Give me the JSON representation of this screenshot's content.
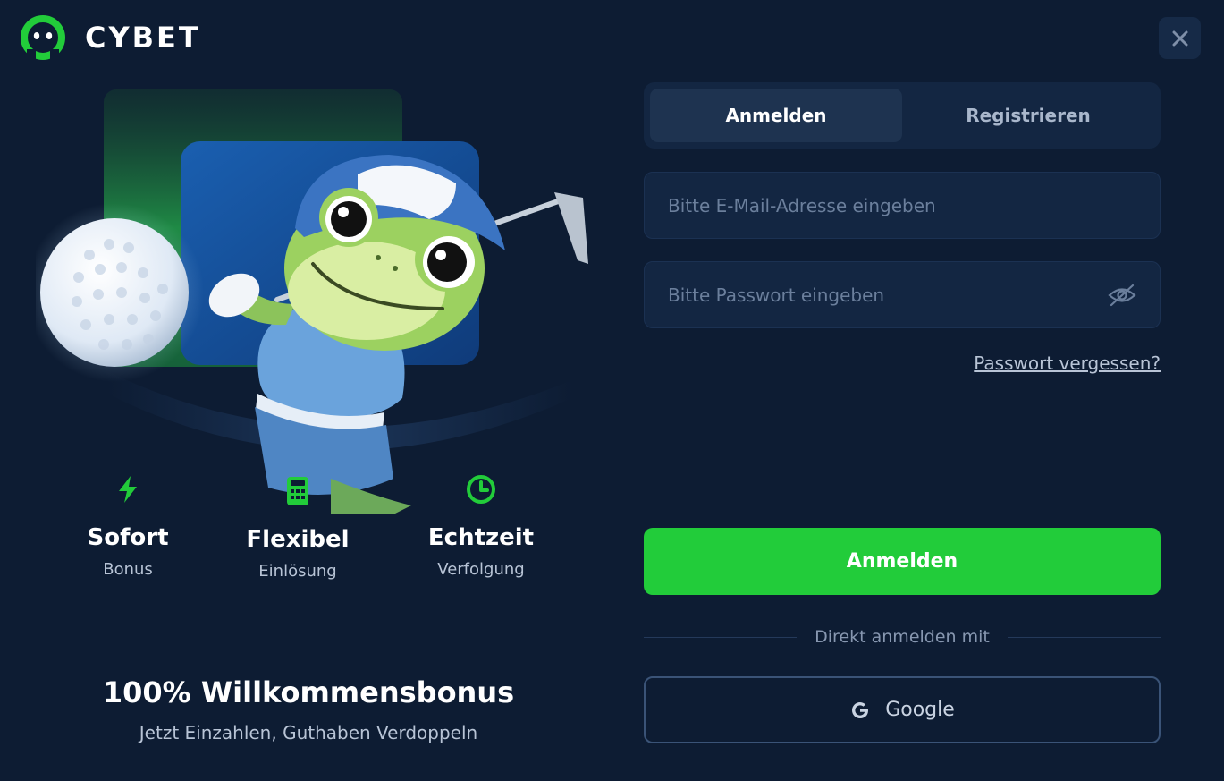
{
  "brand": {
    "name": "CYBET",
    "accent": "#22cc3a",
    "background": "#0d1c33"
  },
  "icons": {
    "logo": "cybet-logo-icon",
    "close": "close-icon",
    "eye": "eye-off-icon",
    "google": "google-icon"
  },
  "features": [
    {
      "icon": "lightning-icon",
      "title": "Sofort",
      "subtitle": "Bonus"
    },
    {
      "icon": "calculator-icon",
      "title": "Flexibel",
      "subtitle": "Einlösung"
    },
    {
      "icon": "clock-icon",
      "title": "Echtzeit",
      "subtitle": "Verfolgung"
    }
  ],
  "promo": {
    "title": "100% Willkommensbonus",
    "subtitle": "Jetzt Einzahlen, Guthaben Verdoppeln"
  },
  "tabs": [
    {
      "label": "Anmelden",
      "active": true
    },
    {
      "label": "Registrieren",
      "active": false
    }
  ],
  "form": {
    "email_value": "",
    "email_placeholder": "Bitte E-Mail-Adresse eingeben",
    "password_value": "",
    "password_placeholder": "Bitte Passwort eingeben",
    "forgot_label": "Passwort vergessen?",
    "submit_label": "Anmelden",
    "divider_label": "Direkt anmelden mit",
    "google_label": "Google"
  }
}
